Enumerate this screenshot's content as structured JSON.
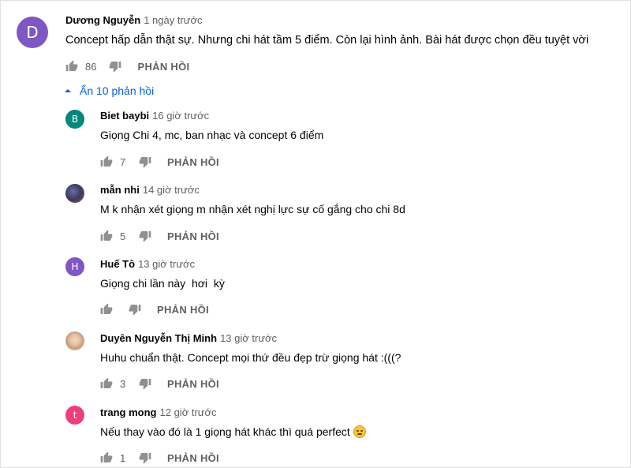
{
  "main_comment": {
    "avatar_letter": "D",
    "avatar_color": "#7e57c2",
    "author": "Dương Nguyễn",
    "time": "1 ngày trước",
    "text": "Concept hấp dẫn thật sự. Nhưng chi hát tầm 5 điểm. Còn lại hình ảnh. Bài hát được chọn đều tuyệt vời",
    "likes": "86",
    "reply_label": "PHẢN HỒI"
  },
  "replies_toggle": {
    "label": "Ẩn 10 phản hồi"
  },
  "replies": [
    {
      "avatar_letter": "B",
      "avatar_color": "#00897b",
      "author": "Biet baybi",
      "time": "16 giờ trước",
      "text": "Giọng Chi 4, mc, ban nhạc và concept 6 điểm",
      "likes": "7",
      "reply_label": "PHẢN HỒI"
    },
    {
      "avatar_letter": "",
      "avatar_color": "#4a4a7a",
      "author": "mẫn nhi",
      "time": "14 giờ trước",
      "text": "M k nhận xét giọng m nhận xét nghị lực sự cố gắng cho chi 8d",
      "likes": "5",
      "reply_label": "PHẢN HỒI"
    },
    {
      "avatar_letter": "H",
      "avatar_color": "#7e57c2",
      "author": "Huế Tô",
      "time": "13 giờ trước",
      "text": "Giọng chi lần này  hơi  kỳ",
      "likes": "",
      "reply_label": "PHẢN HỒI"
    },
    {
      "avatar_letter": "",
      "avatar_color": "#e5c6b0",
      "author": "Duyên Nguyễn Thị Minh",
      "time": "13 giờ trước",
      "text": "Huhu chuẩn thật. Concept mọi thứ đều đẹp trừ giọng hát :(((?",
      "likes": "3",
      "reply_label": "PHẢN HỒI"
    },
    {
      "avatar_letter": "t",
      "avatar_color": "#ec407a",
      "author": "trang mong",
      "time": "12 giờ trước",
      "text": "Nếu thay vào đó là 1 giọng hát khác thì quá perfect",
      "likes": "1",
      "reply_label": "PHẢN HỒI"
    }
  ],
  "icons": {
    "like": "thumb-up-icon",
    "dislike": "thumb-down-icon",
    "toggle": "caret-up-icon",
    "emoji": "disappointed-face-emoji"
  }
}
